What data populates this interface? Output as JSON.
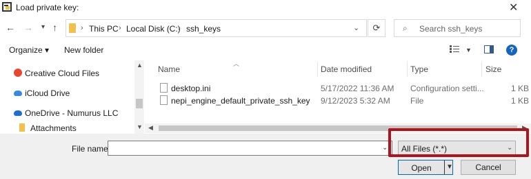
{
  "window": {
    "title": "Load private key:"
  },
  "address": {
    "crumbs": [
      "This PC",
      "Local Disk (C:)",
      "ssh_keys"
    ],
    "search_placeholder": "Search ssh_keys"
  },
  "toolbar": {
    "organize_label": "Organize",
    "new_folder_label": "New folder"
  },
  "nav_pane": {
    "items": [
      {
        "label": "Creative Cloud Files",
        "icon": "creative-cloud-icon"
      },
      {
        "label": "iCloud Drive",
        "icon": "cloud-icon"
      },
      {
        "label": "OneDrive - Numurus LLC",
        "icon": "onedrive-icon"
      },
      {
        "label": "Attachments",
        "icon": "folder-icon"
      }
    ]
  },
  "file_list": {
    "columns": [
      "Name",
      "Date modified",
      "Type",
      "Size"
    ],
    "rows": [
      {
        "name": "desktop.ini",
        "date": "5/17/2022 11:36 AM",
        "type": "Configuration setti...",
        "size": "1 KB"
      },
      {
        "name": "nepi_engine_default_private_ssh_key",
        "date": "9/12/2023 5:32 AM",
        "type": "File",
        "size": "1 KB"
      }
    ]
  },
  "bottom": {
    "file_name_label": "File name:",
    "file_name_value": "",
    "filter_value": "All Files (*.*)",
    "open_label": "Open",
    "cancel_label": "Cancel"
  },
  "colors": {
    "highlight_border": "#b0141a",
    "accent": "#0067c0"
  }
}
